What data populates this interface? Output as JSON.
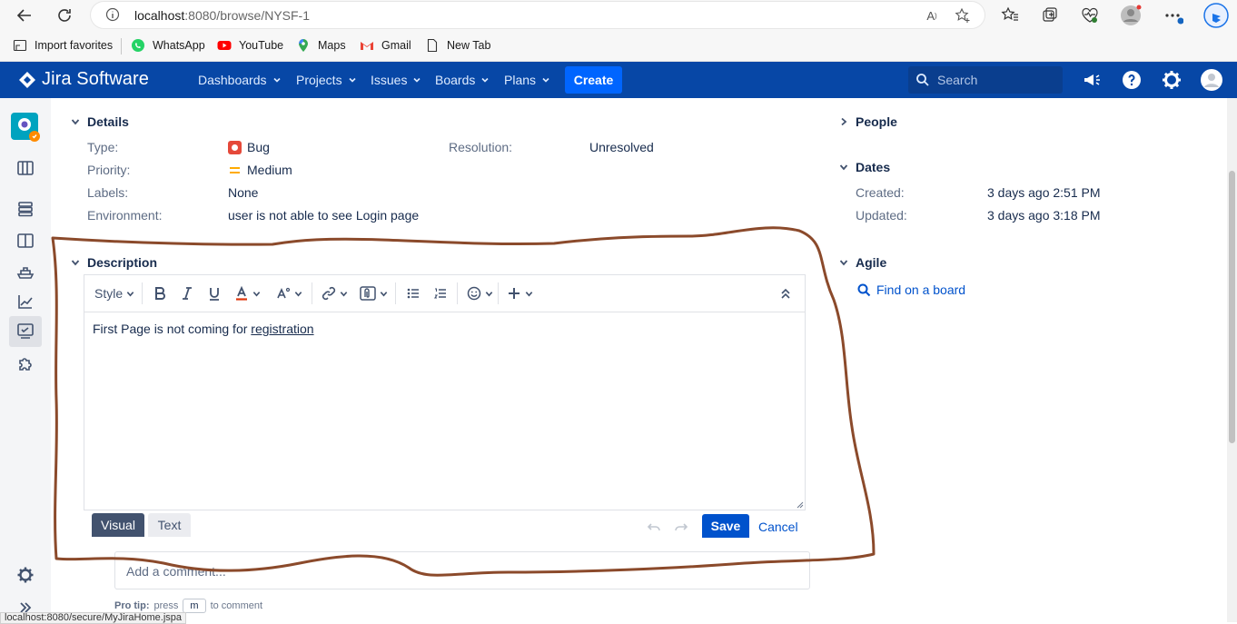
{
  "browser": {
    "url_host": "localhost",
    "url_rest": ":8080/browse/NYSF-1",
    "bookmarks": [
      "Import favorites",
      "WhatsApp",
      "YouTube",
      "Maps",
      "Gmail",
      "New Tab"
    ],
    "status_url": "localhost:8080/secure/MyJiraHome.jspa"
  },
  "jira_nav": {
    "product": "Jira Software",
    "menus": [
      "Dashboards",
      "Projects",
      "Issues",
      "Boards",
      "Plans"
    ],
    "create_label": "Create",
    "search_placeholder": "Search"
  },
  "details": {
    "heading": "Details",
    "type_label": "Type:",
    "type_value": "Bug",
    "priority_label": "Priority:",
    "priority_value": "Medium",
    "labels_label": "Labels:",
    "labels_value": "None",
    "environment_label": "Environment:",
    "environment_value": "user is not able to see Login page",
    "resolution_label": "Resolution:",
    "resolution_value": "Unresolved"
  },
  "people": {
    "heading": "People"
  },
  "dates": {
    "heading": "Dates",
    "created_label": "Created:",
    "created_value": "3 days ago 2:51 PM",
    "updated_label": "Updated:",
    "updated_value": "3 days ago 3:18 PM"
  },
  "agile": {
    "heading": "Agile",
    "link": "Find on a board"
  },
  "description": {
    "heading": "Description",
    "style_label": "Style",
    "content_prefix": "First Page is not coming for ",
    "content_link": "registration",
    "tab_visual": "Visual",
    "tab_text": "Text",
    "save_label": "Save",
    "cancel_label": "Cancel"
  },
  "comment": {
    "placeholder": "Add a comment...",
    "protip_label": "Pro tip:",
    "protip_press": "press",
    "protip_key": "m",
    "protip_rest": "to comment"
  },
  "colors": {
    "nav_bg": "#0747a6",
    "create_bg": "#0065ff",
    "bug_icon": "#e5493a",
    "priority_medium": "#ffab00",
    "annotation_stroke": "#8b4a2b"
  }
}
